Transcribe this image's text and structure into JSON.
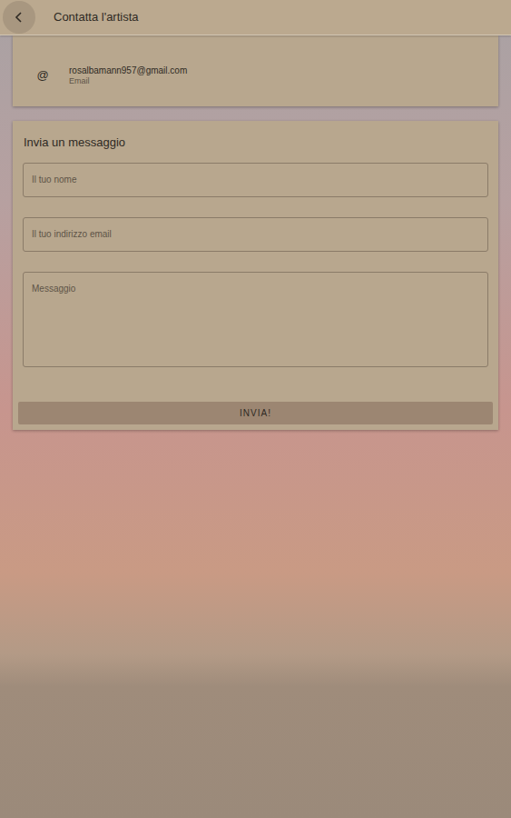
{
  "header": {
    "title": "Contatta l'artista"
  },
  "contact": {
    "icon": "@",
    "value": "rosalbamann957@gmail.com",
    "label": "Email"
  },
  "form": {
    "title": "Invia un messaggio",
    "fields": [
      {
        "placeholder": "Il tuo nome",
        "kind": "input"
      },
      {
        "placeholder": "Il tuo indirizzo email",
        "kind": "input"
      },
      {
        "placeholder": "Messaggio",
        "kind": "textarea"
      }
    ],
    "button": "INVIA!"
  }
}
